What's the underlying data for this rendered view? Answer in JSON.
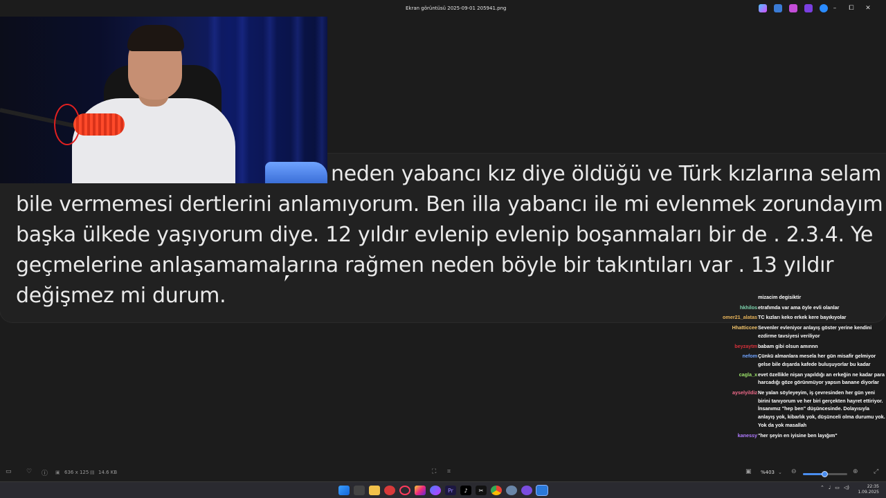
{
  "window": {
    "title": "Ekran görüntüsü 2025-09-01 205941.png",
    "controls": {
      "minimize": "–",
      "maximize": "⧠",
      "close": "✕"
    },
    "title_icons": [
      "copilot-icon",
      "edit-icon",
      "paint-icon",
      "clipchamp-icon",
      "onedrive-icon"
    ]
  },
  "image_text": {
    "lines": [
      "neden yabancı kız diye öldüğü ve Türk kızlarına selam",
      "bile vermemesi dertlerini anlamıyorum. Ben illa yabancı ile mi evlenmek zorundayım",
      "başka ülkede yaşıyorum diye. 12 yıldır evlenip evlenip boşanmaları bir de . 2.3.4. Ye",
      "geçmelerine anlaşamamalarına rağmen neden böyle bir takıntıları var . 13 yıldır",
      "değişmez mi durum."
    ]
  },
  "chat": {
    "messages": [
      {
        "user": "",
        "user_color": "#ffffff",
        "text": "mizacim degisiktir"
      },
      {
        "user": "hkhilos",
        "user_color": "#7fd6b0",
        "text": "etrafımda var ama öyle evli olanlar"
      },
      {
        "user": "omer21_alatas",
        "user_color": "#e8b45a",
        "text": "TC kızları keko erkek kere bayıkıyolar"
      },
      {
        "user": "Hhatticcee",
        "user_color": "#f2c46b",
        "text": "Sevenler evleniyor anlayış göster yerine kendini ezdirme tavsiyesi veriliyor"
      },
      {
        "user": "beyzaytm",
        "user_color": "#d6303a",
        "text": "babam gibi olsun amınnn"
      },
      {
        "user": "nefom",
        "user_color": "#6fa3ff",
        "text": "Çünkü almanlara mesela her gün misafir gelmiyor gelse bile dışarda kafede buluşuyorlar bu kadar"
      },
      {
        "user": "cagla_x",
        "user_color": "#9be26a",
        "text": "evet özellikle nişan yapıldığı an erkeğin ne kadar para harcadığı göze görünmüyor yapsın banane diyorlar"
      },
      {
        "user": "ayselyildiz",
        "user_color": "#f06a8a",
        "text": "Ne yalan söyleyeyim, iş çevresinden her gün yeni birini tanıyorum ve her biri gerçekten hayret ettiriyor. İnsanımız \"hep ben\" düşüncesinde. Dolayısıyla anlayış yok, kibarlık yok, düşünceli olma durumu yok. Yok da yok masallah"
      },
      {
        "user": "kanessy",
        "user_color": "#b07aff",
        "text": "\"her şeyin en iyisine ben layığım\""
      }
    ]
  },
  "statusbar": {
    "dimensions": "636 x 125",
    "filesize": "14.6 KB",
    "zoom": "%403",
    "zoom_level": 0.48
  },
  "taskbar": {
    "apps": [
      "start-icon",
      "file-explorer-icon",
      "folder-icon",
      "game-icon",
      "opera-icon",
      "instagram-icon",
      "messenger-icon",
      "premiere-icon",
      "tiktok-icon",
      "capcut-icon",
      "chrome-icon",
      "settings-icon",
      "copilot-app-icon",
      "photos-icon"
    ],
    "time": "22:35",
    "date": "1.09.2025"
  }
}
